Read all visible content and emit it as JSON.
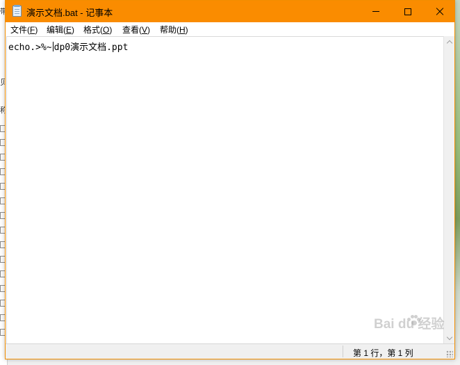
{
  "background": {
    "left_fragments": [
      "带",
      "贝",
      "称"
    ]
  },
  "window": {
    "title": "演示文档.bat - 记事本",
    "accent_color": "#fa8c00",
    "controls": {
      "minimize": "minimize-icon",
      "maximize": "maximize-icon",
      "close": "close-icon"
    }
  },
  "menu": {
    "file": {
      "label": "文件(",
      "key": "F",
      "end": ")"
    },
    "edit": {
      "label": "编辑(",
      "key": "E",
      "end": ")"
    },
    "format": {
      "label": "格式(",
      "key": "O",
      "end": ")"
    },
    "view": {
      "label": "查看(",
      "key": "V",
      "end": ")"
    },
    "help": {
      "label": "帮助(",
      "key": "H",
      "end": ")"
    }
  },
  "editor": {
    "text_before_caret": "echo.>%~",
    "text_after_caret": "dp0演示文档.ppt"
  },
  "statusbar": {
    "position": "第 1 行，第 1 列"
  },
  "watermark": {
    "text": "Bai  du 经验"
  }
}
